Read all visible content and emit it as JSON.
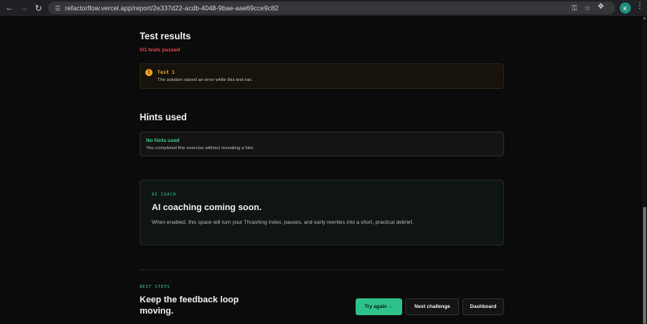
{
  "browser": {
    "url": "refactorflow.vercel.app/report/2e337d22-acdb-4048-9bae-aae69cce9c82",
    "avatar_letter": "K",
    "icons": {
      "back": "arrow-left-icon",
      "forward": "arrow-right-icon",
      "reload": "reload-icon",
      "site_info": "tune-icon",
      "password": "key-icon",
      "bookmark": "star-icon",
      "extensions": "puzzle-icon",
      "menu": "kebab-menu-icon"
    }
  },
  "test_results": {
    "title": "Test results",
    "summary": "0/1 tests passed",
    "tests": [
      {
        "name": "Test 1",
        "message": "The solution raised an error while this test ran.",
        "status_icon": "warning-icon"
      }
    ]
  },
  "hints": {
    "title": "Hints used",
    "status": "No hints used",
    "message": "You completed this exercise without revealing a hint."
  },
  "ai_coach": {
    "eyebrow": "AI COACH",
    "title": "AI coaching coming soon.",
    "body": "When enabled, this space will turn your Thrashing Index, pauses, and early rewrites into a short, practical debrief."
  },
  "next_steps": {
    "eyebrow": "NEXT STEPS",
    "title": "Keep the feedback loop moving.",
    "buttons": {
      "try_again": "Try again →",
      "next_challenge": "Next challenge",
      "dashboard": "Dashboard"
    }
  },
  "colors": {
    "background": "#0b0b0b",
    "accent_green": "#2ec28a",
    "error_red": "#e0484f",
    "warning_amber": "#f0a020"
  }
}
